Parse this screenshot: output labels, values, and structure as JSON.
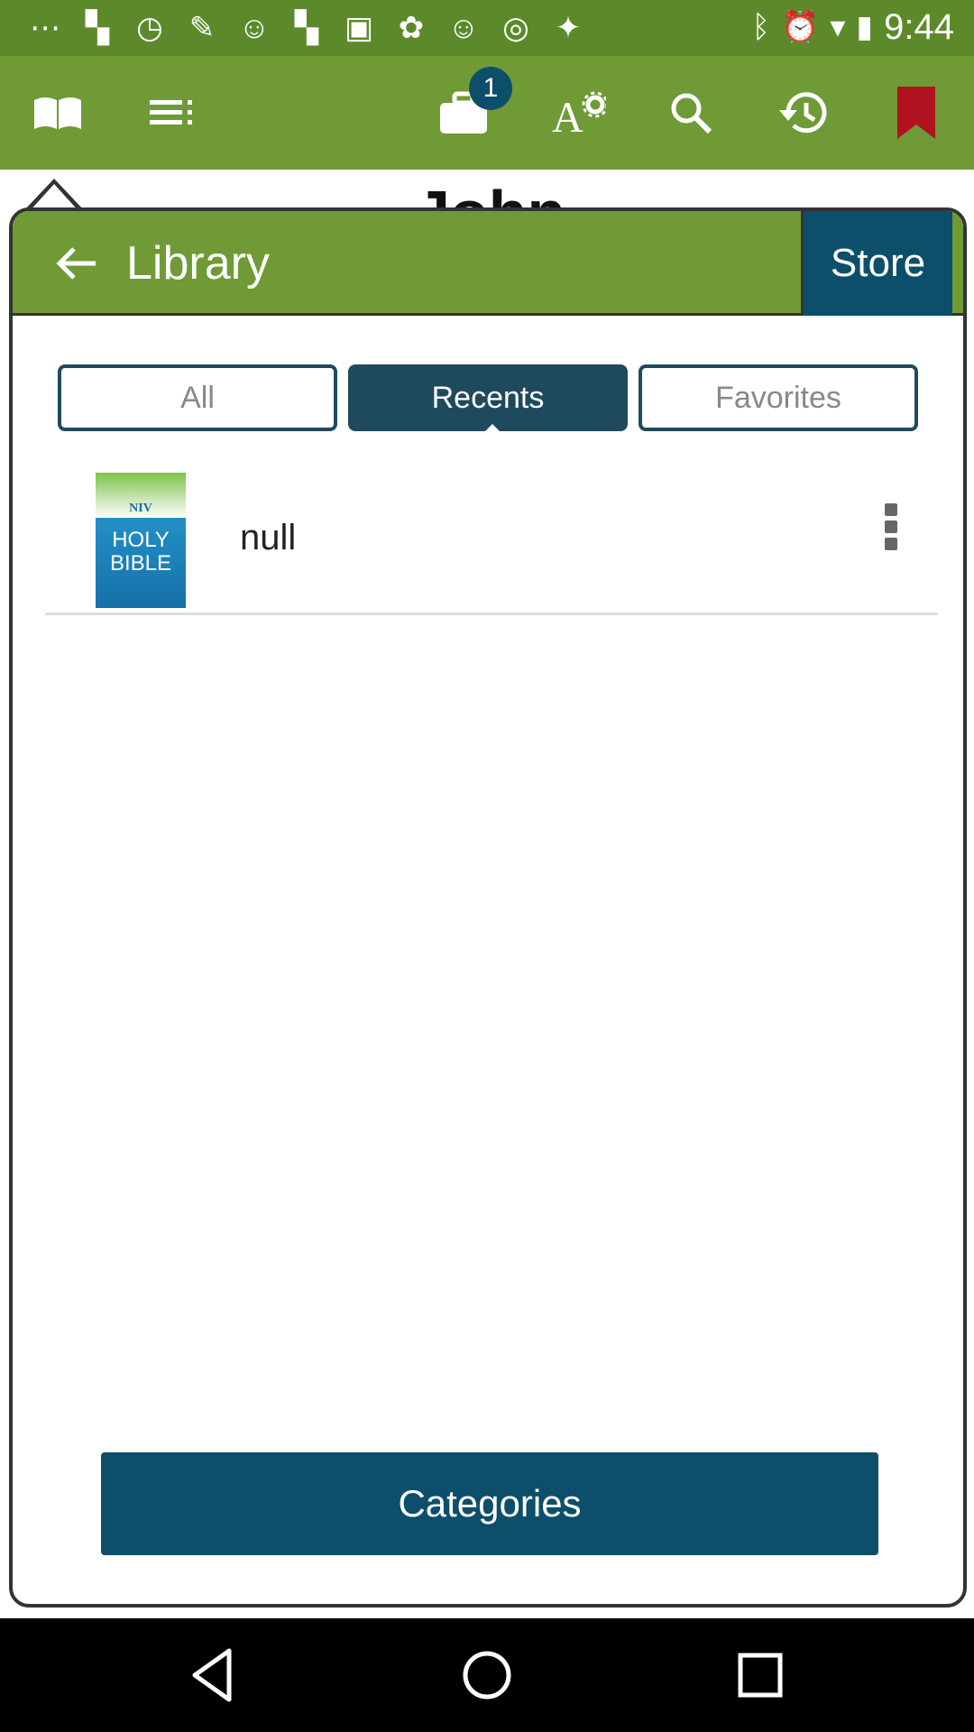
{
  "status_bar": {
    "time": "9:44",
    "left_icons": [
      "more-icon",
      "flipboard-icon",
      "timer-icon",
      "wrench-icon",
      "smiley-icon",
      "flipboard-icon",
      "qq-icon",
      "chinese-char-icon",
      "smiley-icon",
      "target-icon",
      "satellite-icon"
    ],
    "right_icons": [
      "bluetooth-icon",
      "alarm-icon",
      "wifi-icon",
      "battery-icon"
    ]
  },
  "toolbar": {
    "badge_count": "1",
    "behind_title": "John"
  },
  "library": {
    "title": "Library",
    "store_label": "Store",
    "tabs": [
      {
        "label": "All",
        "active": false
      },
      {
        "label": "Recents",
        "active": true
      },
      {
        "label": "Favorites",
        "active": false
      }
    ],
    "items": [
      {
        "title": "null",
        "cover_brand": "NIV",
        "cover_title_line1": "HOLY",
        "cover_title_line2": "BIBLE"
      }
    ],
    "categories_label": "Categories"
  },
  "colors": {
    "toolbar_green": "#6f9a35",
    "accent_blue": "#0d4f6a",
    "bookmark_red": "#b0121f"
  }
}
